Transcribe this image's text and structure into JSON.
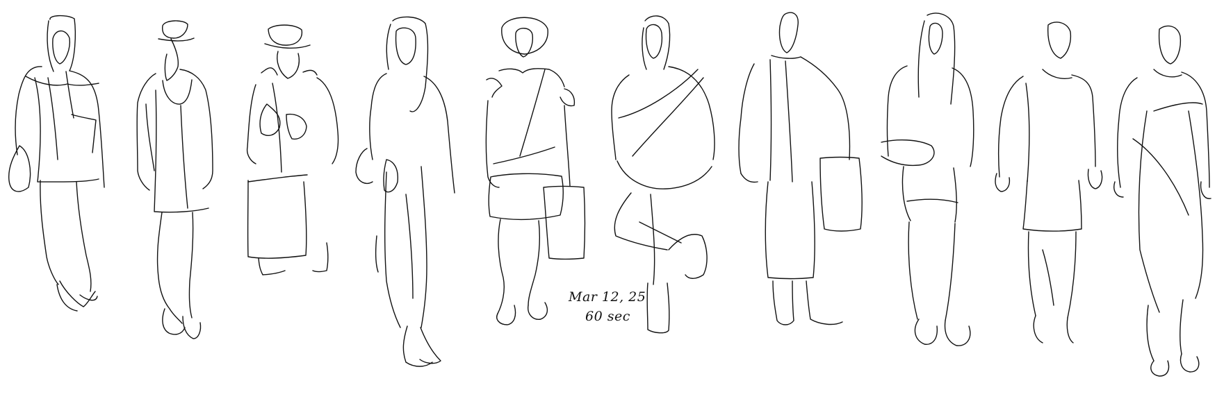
{
  "sketch_note": {
    "date": "Mar 12, 25",
    "duration": "60 sec"
  },
  "colors": {
    "background": "#ffffff",
    "ink": "#111111"
  },
  "figures": [
    {
      "name": "figure-hooded-bag"
    },
    {
      "name": "figure-cap-jacket"
    },
    {
      "name": "figure-hat-coat"
    },
    {
      "name": "figure-long-hair"
    },
    {
      "name": "figure-round-hood-bag"
    },
    {
      "name": "figure-crossed-leg"
    },
    {
      "name": "figure-long-coat"
    },
    {
      "name": "figure-long-hair-shorts"
    },
    {
      "name": "figure-tunic-gloves"
    },
    {
      "name": "figure-draped-dress"
    }
  ]
}
